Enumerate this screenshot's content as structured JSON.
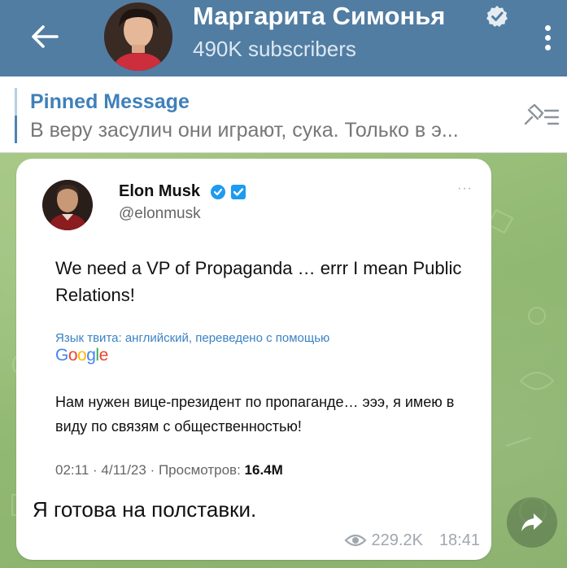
{
  "header": {
    "title": "Маргарита Симонья",
    "subtitle": "490K subscribers",
    "accent_color": "#517da2"
  },
  "pinned": {
    "title": "Pinned Message",
    "text": "В веру засулич они играют, сука. Только в э..."
  },
  "message": {
    "tweet": {
      "name": "Elon Musk",
      "handle": "@elonmusk",
      "more": "···",
      "text": "We need a VP of Propaganda … errr I mean Public Relations!",
      "translation_note": "Язык твита: английский, переведено с помощью",
      "translator_logo": "Google",
      "translated_text": "Нам нужен вице-президент по пропаганде… эээ, я имею в виду по связям с общественностью!",
      "meta_prefix": "02:11 · 4/11/23 · Просмотров: ",
      "views": "16.4M"
    },
    "text": "Я готова на полставки.",
    "views": "229.2K",
    "time": "18:41"
  },
  "icons": {
    "back": "arrow-left-icon",
    "menu": "more-vertical-icon",
    "verified": "verified-icon",
    "unpin": "unpin-icon",
    "views": "eye-icon",
    "share": "share-icon"
  }
}
